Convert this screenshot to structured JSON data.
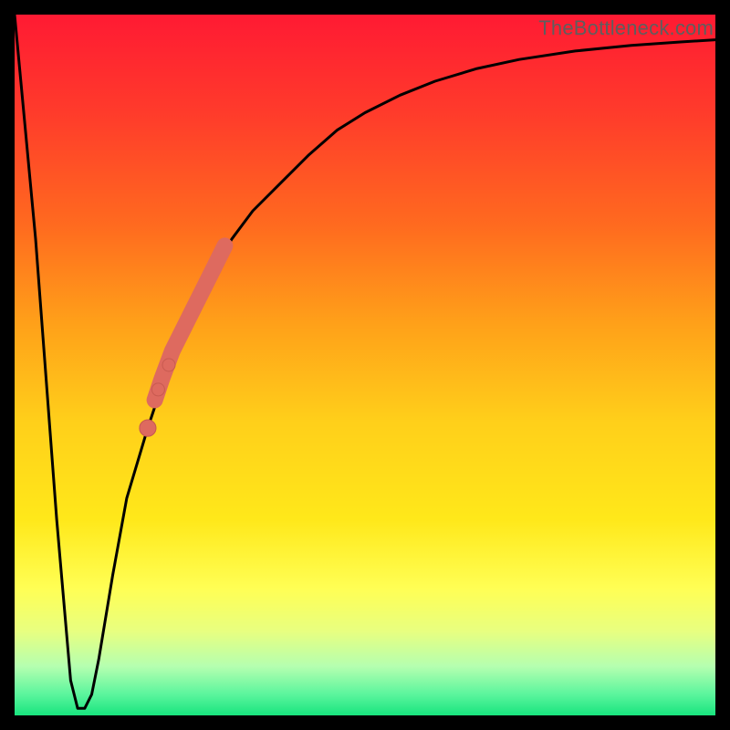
{
  "watermark": "TheBottleneck.com",
  "colors": {
    "curve": "#000000",
    "marker": "#de6a5f",
    "marker_stroke": "#c85a50",
    "frame": "#000000",
    "gradient_top": "#ff1a33",
    "gradient_bottom": "#18e47e"
  },
  "chart_data": {
    "type": "line",
    "title": "",
    "xlabel": "",
    "ylabel": "",
    "xlim": [
      0,
      100
    ],
    "ylim": [
      0,
      100
    ],
    "grid": false,
    "legend": false,
    "series": [
      {
        "name": "bottleneck-curve",
        "x": [
          0,
          3,
          6,
          8,
          9,
          10,
          11,
          12,
          14,
          16,
          19,
          22,
          25,
          28,
          31,
          34,
          38,
          42,
          46,
          50,
          55,
          60,
          66,
          72,
          80,
          88,
          95,
          100
        ],
        "values": [
          100,
          68,
          28,
          5,
          1,
          1,
          3,
          8,
          20,
          31,
          41,
          50,
          57,
          63,
          68,
          72,
          76,
          80,
          83.5,
          86,
          88.5,
          90.5,
          92.3,
          93.6,
          94.8,
          95.6,
          96.1,
          96.4
        ]
      }
    ],
    "markers": {
      "name": "highlighted-points",
      "x": [
        19,
        20,
        21,
        22.5,
        24,
        25.5,
        27,
        28.5,
        30,
        20.5,
        22
      ],
      "values": [
        41,
        45,
        48,
        52,
        55,
        58,
        61,
        64,
        67,
        46.5,
        50
      ],
      "radius": [
        9,
        13,
        13,
        13,
        13,
        13,
        13,
        13,
        13,
        7,
        7
      ]
    }
  }
}
